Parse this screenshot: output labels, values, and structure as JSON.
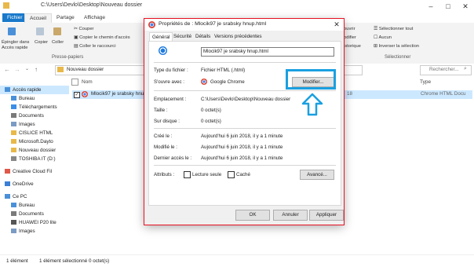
{
  "window": {
    "path": "C:\\Users\\Devlo\\Desktop\\Nouveau dossier",
    "controls": [
      "–",
      "□",
      "✕"
    ]
  },
  "ribbon": {
    "tabs": [
      "Fichier",
      "Accueil",
      "Partage",
      "Affichage"
    ],
    "pin_label": "Épingler dans Accès rapide",
    "copy_label": "Copier",
    "paste_label": "Coller",
    "cut_label": "Couper",
    "copy_path_label": "Copier le chemin d'accès",
    "paste_shortcut_label": "Coller le raccourci",
    "clipboard_group": "Presse-papiers",
    "open_label": "ouvrir",
    "modify_label": "odifier",
    "history_label": "istorique",
    "select_all_label": "Sélectionner tout",
    "select_none_label": "Aucun",
    "invert_selection_label": "Inverser la sélection",
    "selection_group": "Sélectionner"
  },
  "address": {
    "current": "Nouveau dossier",
    "search_placeholder": "Rechercher..."
  },
  "nav": {
    "items": [
      {
        "label": "Accès rapide",
        "selected": true
      },
      {
        "label": "Bureau"
      },
      {
        "label": "Téléchargements"
      },
      {
        "label": "Documents"
      },
      {
        "label": "Images"
      },
      {
        "label": "CISLICE HTML"
      },
      {
        "label": "Microsoft.Dayto"
      },
      {
        "label": "Nouveau dossier"
      },
      {
        "label": "TOSHIBA IT (D:)"
      },
      {
        "label": "Creative Cloud Fil"
      },
      {
        "label": "OneDrive"
      },
      {
        "label": "Ce PC"
      },
      {
        "label": "Bureau"
      },
      {
        "label": "Documents"
      },
      {
        "label": "HUAWEI P20 lite"
      },
      {
        "label": "Images"
      }
    ]
  },
  "content": {
    "col_name": "Nom",
    "col_type": "Type",
    "file_name": "Mlocik97 je srabsky hnup.html",
    "file_date_fragment": "18",
    "file_type": "Chrome HTML Docu"
  },
  "status": {
    "count": "1 élément",
    "selected": "1 élément sélectionné  0 octet(s)"
  },
  "dialog": {
    "title": "Propriétés de : Mlocik97 je srabsky hnup.html",
    "close": "✕",
    "tabs": [
      "Général",
      "Sécurité",
      "Détails",
      "Versions précédentes"
    ],
    "filename": "Mlocik97 je srabsky hnup.html",
    "file_type_label": "Type du fichier :",
    "file_type_value": "Fichier HTML (.html)",
    "opens_with_label": "S'ouvre avec :",
    "opens_with_value": "Google Chrome",
    "modify_button": "Modifier...",
    "location_label": "Emplacement :",
    "location_value": "C:\\Users\\Devlo\\Desktop\\Nouveau dossier",
    "size_label": "Taille :",
    "size_value": "0 octet(s)",
    "disk_size_label": "Sur disque :",
    "disk_size_value": "0 octet(s)",
    "created_label": "Créé le :",
    "created_value": "Aujourd'hui 6 juin 2018, il y a 1 minute",
    "modified_label": "Modifié le :",
    "modified_value": "Aujourd'hui 6 juin 2018, il y a 1 minute",
    "accessed_label": "Dernier accès le :",
    "accessed_value": "Aujourd'hui 6 juin 2018, il y a 1 minute",
    "attributes_label": "Attributs :",
    "readonly_label": "Lecture seule",
    "hidden_label": "Caché",
    "advanced_button": "Avancé...",
    "ok_button": "OK",
    "cancel_button": "Annuler",
    "apply_button": "Appliquer"
  },
  "colors": {
    "accent_red": "#e81123",
    "highlight_blue": "#1aa0e0",
    "file_tab_blue": "#1979ca"
  }
}
